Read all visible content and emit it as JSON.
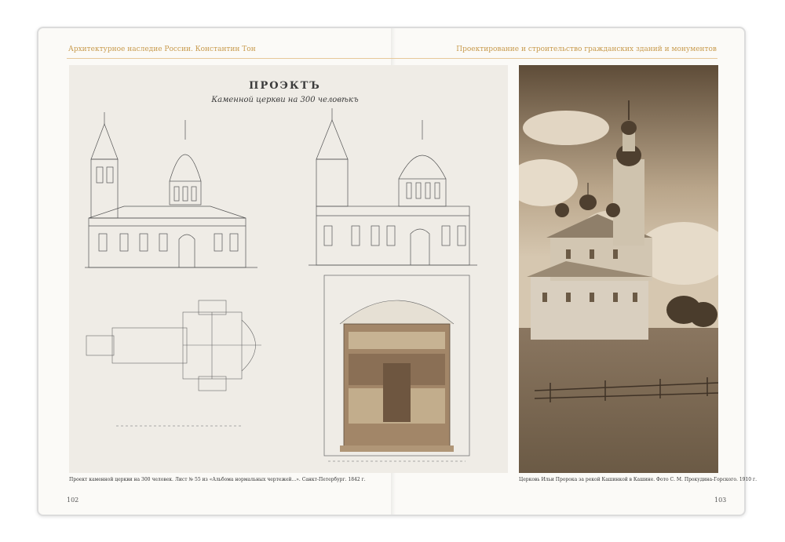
{
  "header": {
    "left": "Архитектурное наследие России. Константин Тон",
    "right": "Проектирование и строительство гражданских зданий и монументов"
  },
  "plate": {
    "title": "ПРОЭКТЪ",
    "subtitle": "Каменной церкви на 300 человѣкъ"
  },
  "captions": {
    "left": "Проект каменной церкви на 300 человек. Лист № 55 из «Альбома нормальных чертежей...». Санкт-Петербург. 1842 г.",
    "right": "Церковь Ильи Пророка за рекой Кашинкой в Кашине. Фото С. М. Прокудина-Горского. 1910 г."
  },
  "pages": {
    "left": "102",
    "right": "103"
  },
  "colors": {
    "accent": "#c89b4e",
    "plate_bg": "#efece6",
    "sepia": "#6b5a45"
  }
}
